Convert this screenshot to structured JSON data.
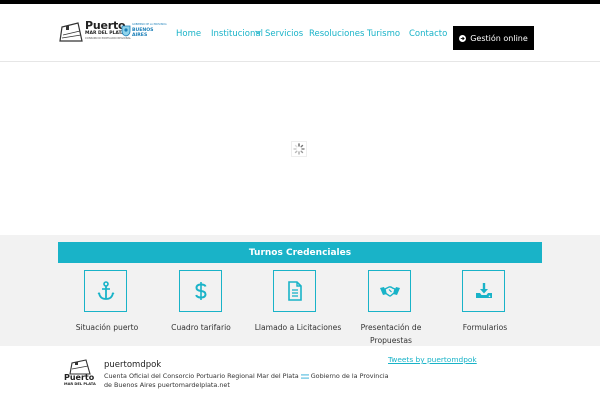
{
  "header": {
    "logo": {
      "name": "Puerto",
      "subname": "MAR DEL PLATA",
      "tagline": "CONSORCIO PORTUARIO REGIONAL",
      "province_top": "GOBIERNO DE LA PROVINCIA",
      "province": "BUENOS AIRES"
    },
    "nav": [
      {
        "label": "Home"
      },
      {
        "label": "Institucional"
      },
      {
        "label": "Servicios"
      },
      {
        "label": "Resoluciones"
      },
      {
        "label": "Turismo"
      },
      {
        "label": "Contacto"
      }
    ],
    "cta_label": "Gestión online"
  },
  "band": {
    "title": "Turnos Credenciales",
    "items": [
      {
        "label": "Situación puerto",
        "icon": "anchor-icon"
      },
      {
        "label": "Cuadro tarifario",
        "icon": "dollar-icon"
      },
      {
        "label": "Llamado a Licitaciones",
        "icon": "document-icon"
      },
      {
        "label": "Presentación de Propuestas",
        "icon": "handshake-icon"
      },
      {
        "label": "Formularios",
        "icon": "download-icon"
      }
    ]
  },
  "footer": {
    "logo_name": "Puerto",
    "logo_subname": "MAR DEL PLATA",
    "handle": "puertomdpok",
    "description_1": "Cuenta Oficial del Consorcio Portuario Regional Mar del Plata",
    "description_2": "Gobierno de la Provincia de Buenos Aires puertomardelplata.net",
    "tweets_link": "Tweets by puertomdpok"
  },
  "colors": {
    "accent": "#19b3c8",
    "dark": "#000000",
    "band_bg": "#f2f2f2"
  }
}
